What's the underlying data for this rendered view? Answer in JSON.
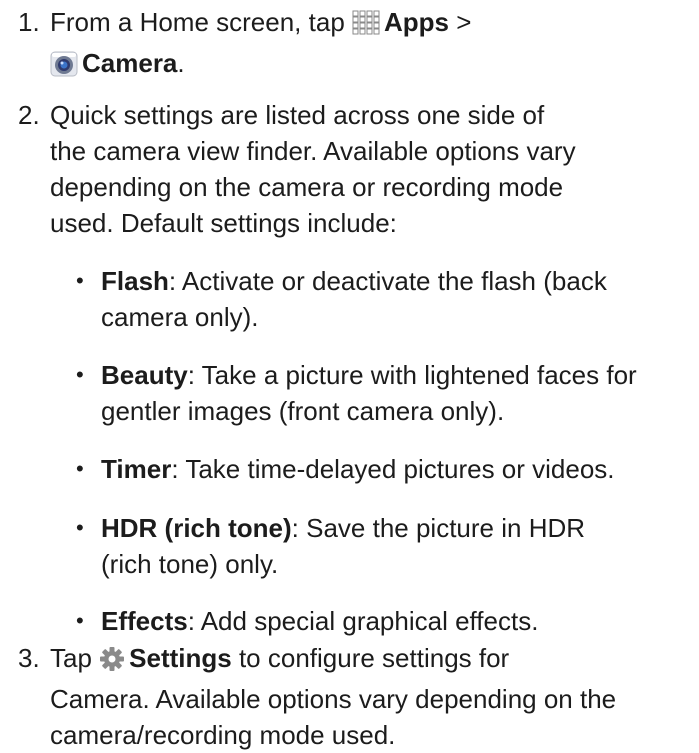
{
  "steps": [
    {
      "number": "1.",
      "pre": "From a Home screen, tap",
      "apps_label": "Apps",
      "sep": ">",
      "camera_label": "Camera",
      "end": "."
    },
    {
      "number": "2.",
      "lines": [
        "Quick settings are listed across one side of",
        "the camera view finder. Available options vary",
        "depending on the camera or recording mode",
        "used. Default settings include:"
      ],
      "bullets": [
        {
          "term": "Flash",
          "lines": [
            ": Activate or deactivate the flash (back",
            "camera only)."
          ]
        },
        {
          "term": "Beauty",
          "lines": [
            ": Take a picture with lightened faces for",
            "gentler images (front camera only)."
          ]
        },
        {
          "term": "Timer",
          "lines": [
            ": Take time-delayed pictures or videos."
          ]
        },
        {
          "term": "HDR (rich tone)",
          "lines": [
            ": Save the picture in HDR",
            "(rich tone) only."
          ]
        },
        {
          "term": "Effects",
          "lines": [
            ": Add special graphical effects."
          ]
        }
      ]
    },
    {
      "number": "3.",
      "pre": "Tap",
      "settings_label": "Settings",
      "lines": [
        " to configure settings for",
        "Camera. Available options vary depending on the",
        "camera/recording mode used."
      ]
    }
  ],
  "icons": {
    "apps": "apps-grid-icon",
    "camera": "camera-lens-icon",
    "settings": "gear-icon"
  },
  "colors": {
    "text": "#1c1c1c",
    "icon_gray": "#8a8a8a"
  }
}
